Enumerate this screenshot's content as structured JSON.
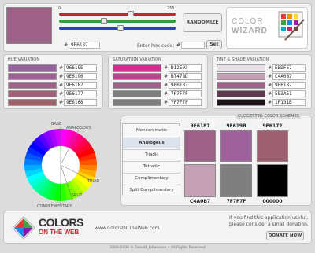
{
  "top": {
    "preview_color": "#9E6187",
    "slider_min": "0",
    "slider_max": "255",
    "sliders": [
      {
        "channel": "red",
        "value": 158
      },
      {
        "channel": "green",
        "value": 97
      },
      {
        "channel": "blue",
        "value": 135
      }
    ],
    "current_hex": "9E6187",
    "randomize_label": "RANDOMIZE",
    "enter_hex_label": "Enter hex code:",
    "enter_hex_hash": "#",
    "set_label": "Set",
    "logo_line1": "COLOR",
    "logo_line2": "WIZARD"
  },
  "hash": "#",
  "hue": {
    "title": "HUE VARIATION",
    "items": [
      {
        "hex": "96619E",
        "color": "#96619E"
      },
      {
        "hex": "9E6196",
        "color": "#9E6196"
      },
      {
        "hex": "9E6187",
        "color": "#9E6187"
      },
      {
        "hex": "9E6177",
        "color": "#9E6177"
      },
      {
        "hex": "9E6168",
        "color": "#9E6168"
      }
    ]
  },
  "saturation": {
    "title": "SATURATION VARIATION",
    "items": [
      {
        "hex": "D12E93",
        "color": "#D12E93"
      },
      {
        "hex": "B7478D",
        "color": "#B7478D"
      },
      {
        "hex": "9E6187",
        "color": "#9E6187"
      },
      {
        "hex": "7F7F7F",
        "color": "#7F7F7F"
      },
      {
        "hex": "7F7F7F",
        "color": "#7F7F7F"
      }
    ]
  },
  "tint": {
    "title": "TINT & SHADE VARIATION",
    "items": [
      {
        "hex": "EBDFE7",
        "color": "#EBDFE7"
      },
      {
        "hex": "C4A0B7",
        "color": "#C4A0B7"
      },
      {
        "hex": "9E6187",
        "color": "#9E6187"
      },
      {
        "hex": "5E3A51",
        "color": "#5E3A51"
      },
      {
        "hex": "1F131B",
        "color": "#1F131B"
      }
    ]
  },
  "wheel": {
    "labels": [
      "BASE",
      "ANALOGOUS",
      "TRIAD",
      "SPLIT",
      "COMPLEMENTARY"
    ]
  },
  "schemes": {
    "title": "SUGGESTED COLOR SCHEMES",
    "buttons": [
      {
        "label": "Monocromatic",
        "active": false
      },
      {
        "label": "Analogous",
        "active": true
      },
      {
        "label": "Triadic",
        "active": false
      },
      {
        "label": "Tetradic",
        "active": false
      },
      {
        "label": "Complimentary",
        "active": false
      },
      {
        "label": "Split Complimentary",
        "active": false
      }
    ],
    "colors": [
      {
        "hex": "9E6187",
        "color": "#9E6187"
      },
      {
        "hex": "9E619B",
        "color": "#9E619B"
      },
      {
        "hex": "9E6172",
        "color": "#9E6172"
      },
      {
        "hex": "C4A0B7",
        "color": "#C4A0B7"
      },
      {
        "hex": "7F7F7F",
        "color": "#7F7F7F"
      },
      {
        "hex": "000000",
        "color": "#000000"
      }
    ]
  },
  "footer": {
    "brand1": "COLORS",
    "brand2": "ON THE WEB",
    "url": "www.ColorsOnTheWeb.com",
    "donate_text1": "If you find this application useful,",
    "donate_text2": "please consider a small donation.",
    "donate_label": "DONATE NOW",
    "copyright": "2000-2006 © Donald Johansson • All Rights Reserved"
  }
}
